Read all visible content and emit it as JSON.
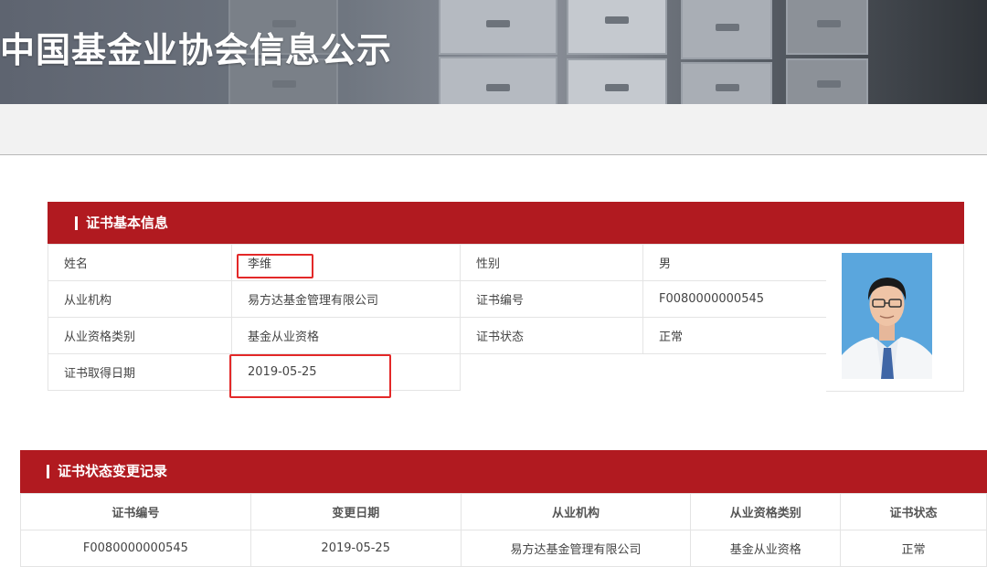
{
  "banner": {
    "title": "中国基金业协会信息公示"
  },
  "basic_info": {
    "header": "证书基本信息",
    "rows": [
      {
        "label1": "姓名",
        "value1": "李维",
        "label2": "性别",
        "value2": "男"
      },
      {
        "label1": "从业机构",
        "value1": "易方达基金管理有限公司",
        "label2": "证书编号",
        "value2": "F0080000000545"
      },
      {
        "label1": "从业资格类别",
        "value1": "基金从业资格",
        "label2": "证书状态",
        "value2": "正常"
      }
    ],
    "last_row": {
      "label": "证书取得日期",
      "value": "2019-05-25"
    }
  },
  "records": {
    "header": "证书状态变更记录",
    "columns": [
      "证书编号",
      "变更日期",
      "从业机构",
      "从业资格类别",
      "证书状态"
    ],
    "rows": [
      [
        "F0080000000545",
        "2019-05-25",
        "易方达基金管理有限公司",
        "基金从业资格",
        "正常"
      ]
    ]
  },
  "colors": {
    "accent_red": "#b11a20",
    "highlight_box": "#e32828"
  }
}
